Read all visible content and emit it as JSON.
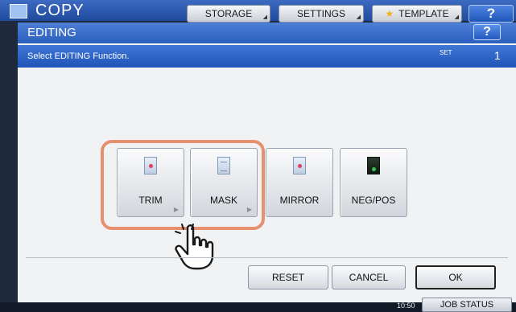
{
  "app": {
    "title": "COPY",
    "top_buttons": [
      "STORAGE",
      "SETTINGS",
      "TEMPLATE"
    ],
    "help_label": "?"
  },
  "dialog": {
    "title": "EDITING",
    "help_label": "?",
    "instruction": "Select EDITING Function.",
    "set_label": "SET",
    "set_value": "1",
    "functions": [
      {
        "label": "TRIM",
        "icon": "trim-document-icon"
      },
      {
        "label": "MASK",
        "icon": "mask-document-icon"
      },
      {
        "label": "MIRROR",
        "icon": "mirror-document-icon"
      },
      {
        "label": "NEG/POS",
        "icon": "negpos-document-icon"
      }
    ],
    "buttons": {
      "reset": "RESET",
      "cancel": "CANCEL",
      "ok": "OK"
    },
    "highlight_color": "#e6906f"
  },
  "status_bar": {
    "time_small": "",
    "time": "10:50",
    "job_status": "JOB STATUS"
  },
  "colors": {
    "accent": "#2b5fbe",
    "highlight": "#e6906f"
  }
}
